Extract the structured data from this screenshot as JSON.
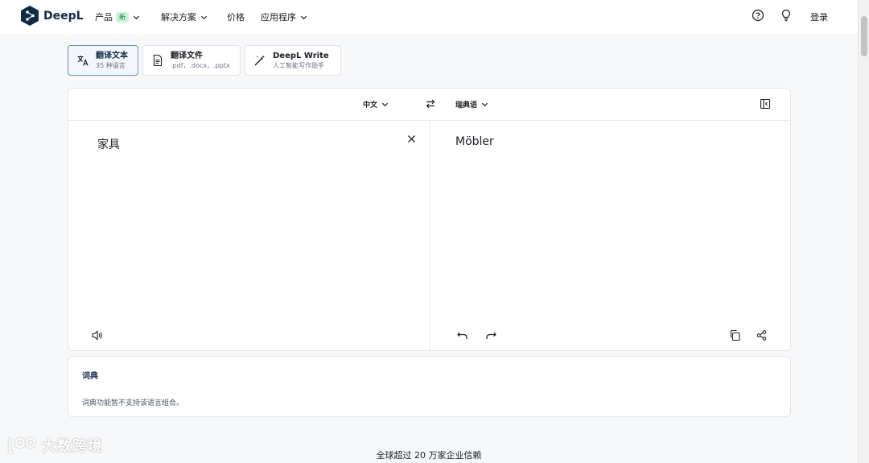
{
  "brand": {
    "name": "DeepL",
    "accent": "#0f2b46"
  },
  "nav": {
    "items": [
      {
        "label": "产品",
        "badge": "新"
      },
      {
        "label": "解决方案"
      },
      {
        "label": "价格"
      },
      {
        "label": "应用程序"
      }
    ],
    "icons": [
      "help-icon",
      "lightbulb-icon"
    ],
    "login_label": "登录"
  },
  "modes": [
    {
      "title": "翻译文本",
      "subtitle": "35 种语言",
      "icon": "translate-icon",
      "active": true
    },
    {
      "title": "翻译文件",
      "subtitle": ".pdf，.docx，.pptx",
      "icon": "document-icon",
      "active": false
    },
    {
      "title": "DeepL Write",
      "subtitle": "人工智能写作助手",
      "icon": "magic-wand-icon",
      "active": false
    }
  ],
  "translator": {
    "source_lang": "中文",
    "target_lang": "瑞典语",
    "source_text": "家具",
    "target_text": "Möbler"
  },
  "dictionary": {
    "title": "词典",
    "note": "词典功能暂不支持该语言组合。"
  },
  "trust_text": "全球超过 20 万家企业信赖",
  "watermark": {
    "text": "大数跨境"
  }
}
